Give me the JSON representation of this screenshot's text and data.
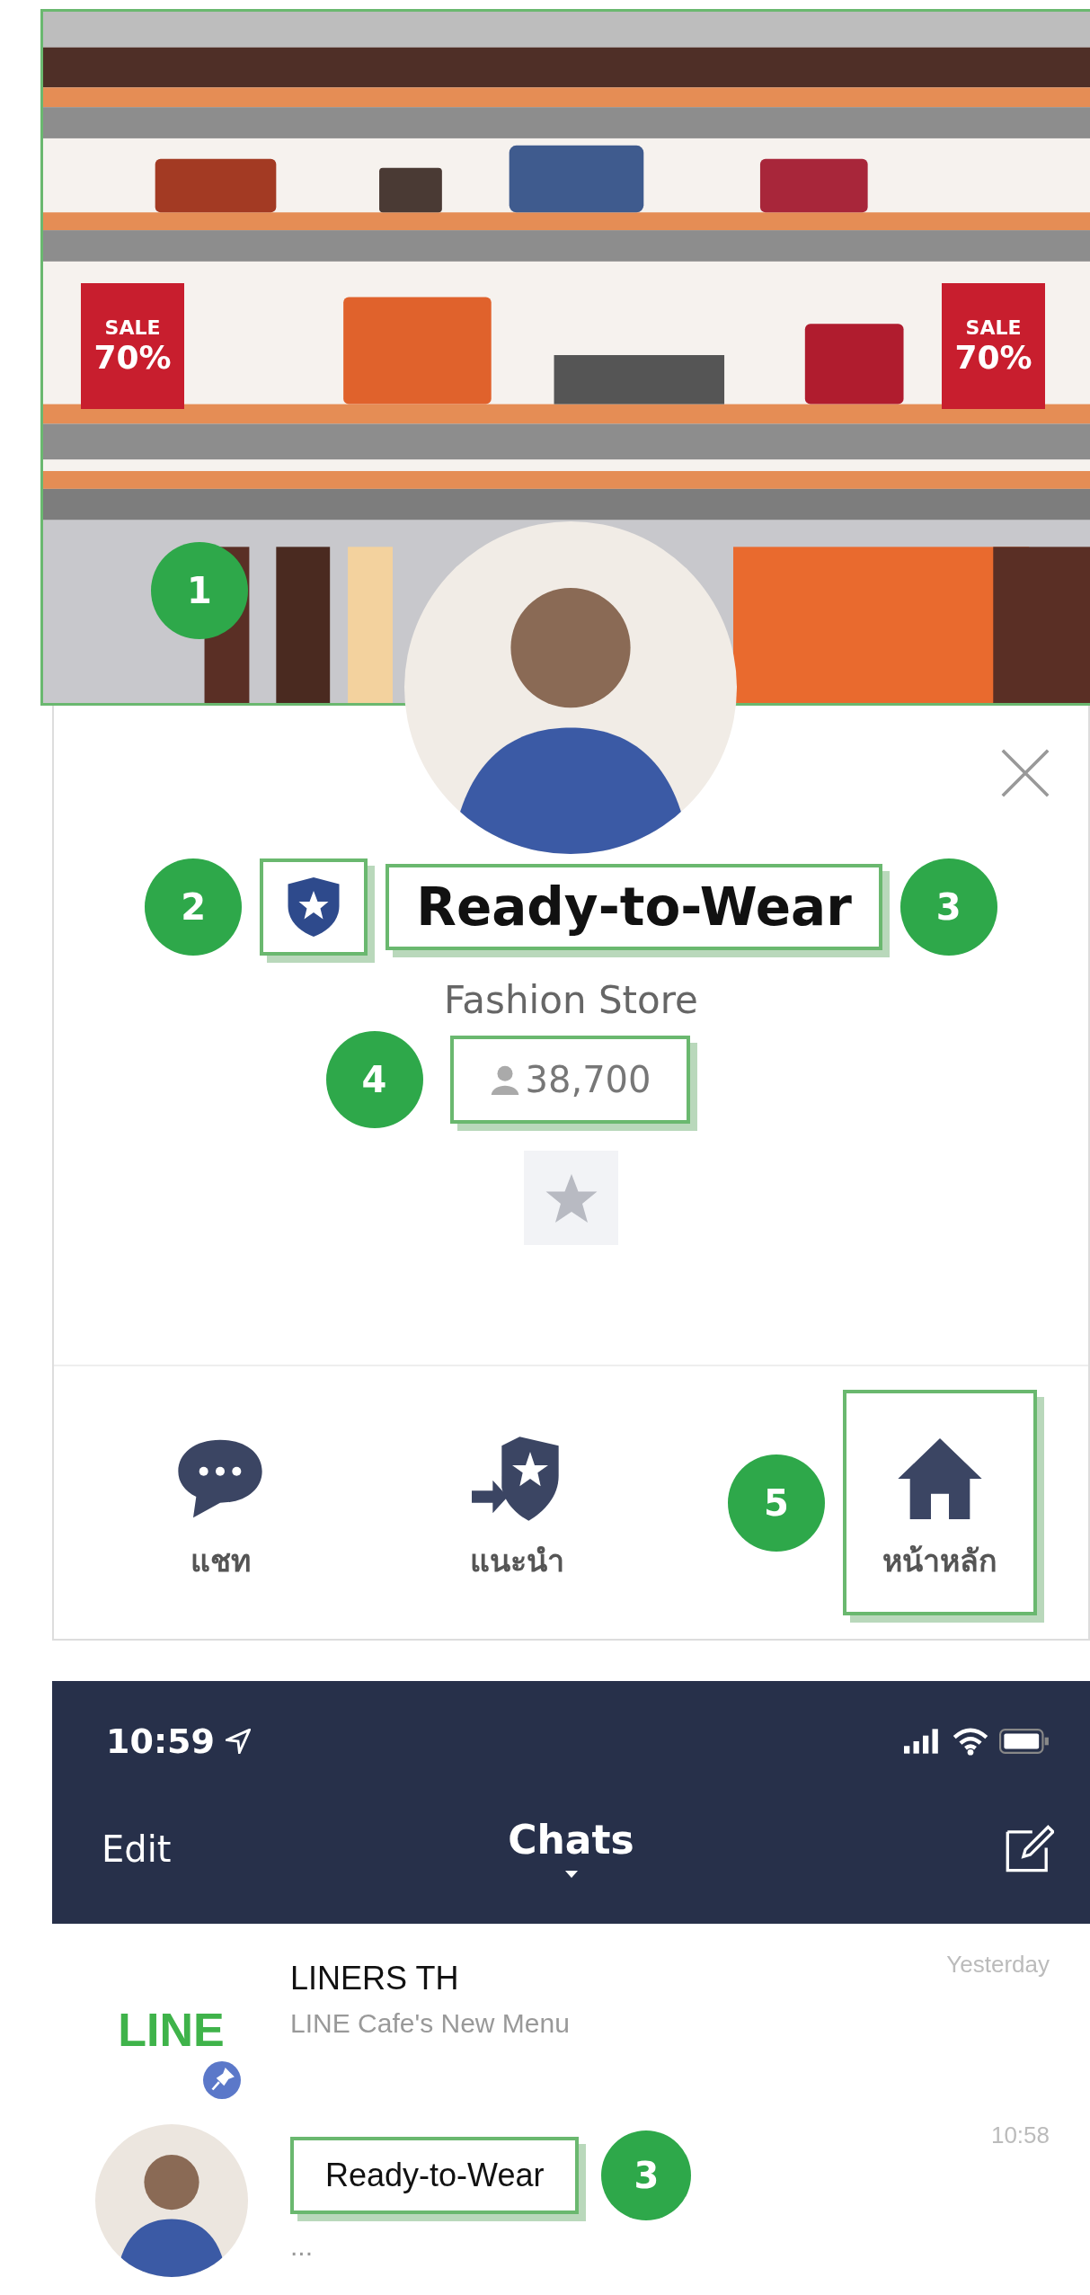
{
  "cover": {
    "annotation": "1",
    "signs": [
      {
        "line1": "SALE",
        "line2": "70%"
      },
      {
        "line1": "SALE",
        "line2": "70%"
      }
    ]
  },
  "profile": {
    "badge_annotation": "2",
    "name": "Ready-to-Wear",
    "name_annotation": "3",
    "category": "Fashion Store",
    "followers": "38,700",
    "followers_annotation": "4"
  },
  "actions": [
    {
      "kind": "chat",
      "label": "แชท",
      "highlighted": false
    },
    {
      "kind": "recommend",
      "label": "แนะนำ",
      "highlighted": false
    },
    {
      "kind": "home",
      "label": "หน้าหลัก",
      "highlighted": true,
      "annotation": "5"
    }
  ],
  "chat_screen": {
    "status_time": "10:59",
    "nav": {
      "left": "Edit",
      "title": "Chats"
    },
    "rows": [
      {
        "kind": "logo",
        "logo_text": "LINE",
        "name": "LINERS TH",
        "preview": "LINE Cafe's New Menu",
        "time": "Yesterday",
        "pinned": true,
        "highlighted": false
      },
      {
        "kind": "avatar",
        "name": "Ready-to-Wear",
        "preview": "...",
        "time": "10:58",
        "pinned": false,
        "highlighted": true,
        "annotation": "3"
      }
    ]
  }
}
